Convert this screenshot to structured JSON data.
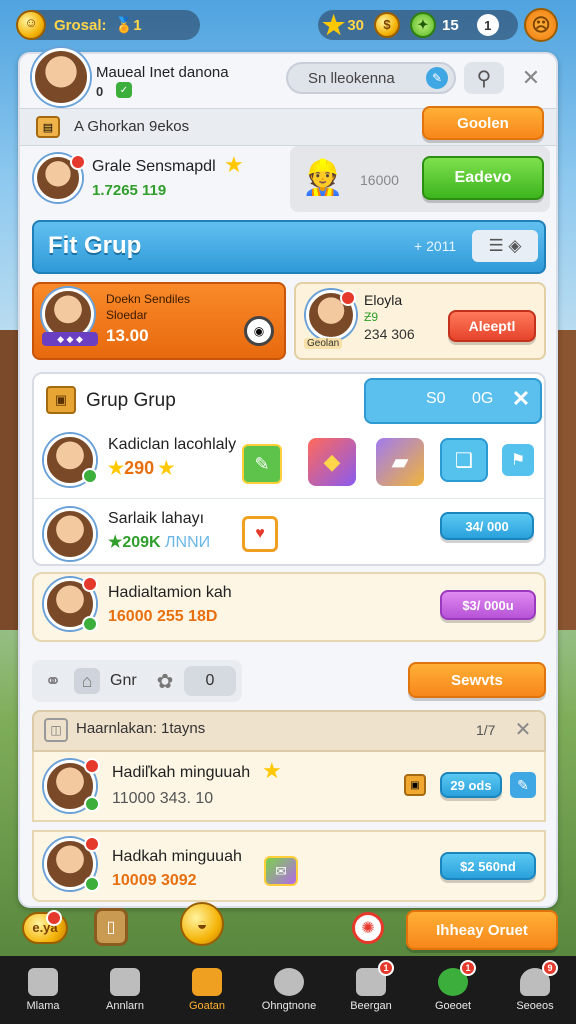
{
  "top": {
    "name": "Grosal:",
    "level": "🏅1",
    "stars": "30",
    "gems": "15",
    "notif": "1"
  },
  "profile": {
    "name": "Maueal Inet danona",
    "sub": "0",
    "search_placeholder": "Sn lleokenna",
    "section_label": "A Ghorkan 9ekos",
    "section_button": "Goolen"
  },
  "player": {
    "name": "Grale Sensmapdl",
    "score": "1.7265 119",
    "card_label": "16000",
    "card_sub": "",
    "button": "Eadevo"
  },
  "header": {
    "title": "Fit Grup",
    "count": "+ 2011"
  },
  "cards": {
    "left": {
      "line1": "Doekn Sendiles",
      "line2": "Sloedar",
      "value": "13.00"
    },
    "right": {
      "name": "Eloyla",
      "line2": "Ƶ9",
      "value": "234 306",
      "tag": "Geolan",
      "button": "Aleeptl"
    }
  },
  "group": {
    "title": "Grup Grup",
    "pill_a": "S0",
    "pill_b": "0G",
    "members": [
      {
        "name": "Kadiclan lacohlaly",
        "score": "290"
      },
      {
        "name": "Sarlaik lahayı",
        "score": "209K",
        "extra": "ЛNNИ",
        "price": "34/ 000"
      }
    ]
  },
  "gift": {
    "name": "Hadialtamion kah",
    "value": "16000 255 18D",
    "button": "$3/ 000u"
  },
  "toolbar": {
    "label": "Gnr",
    "num": "0",
    "button": "Sewvts"
  },
  "history": {
    "title": "Haarnlakan: 1tayns",
    "count": "1/7",
    "items": [
      {
        "name": "Hadiľkah minguuah",
        "value": "11000 343. 10",
        "price": "29 ods"
      },
      {
        "name": "Hadkah minguuah",
        "value": "10009 3092",
        "price": "$2 560nd"
      }
    ]
  },
  "bottom": {
    "coins": "e.ya",
    "button": "Ihheay Oruet"
  },
  "nav": [
    {
      "label": "Mlama",
      "active": false,
      "badge": ""
    },
    {
      "label": "Annlarn",
      "active": false,
      "badge": ""
    },
    {
      "label": "Goatan",
      "active": true,
      "badge": ""
    },
    {
      "label": "Ohngtnone",
      "active": false,
      "badge": ""
    },
    {
      "label": "Beergan",
      "active": false,
      "badge": "1"
    },
    {
      "label": "Goeoet",
      "active": false,
      "badge": "1"
    },
    {
      "label": "Seoeos",
      "active": false,
      "badge": "9"
    }
  ],
  "colors": {
    "accent": "#2aa1dc",
    "orange": "#f7871a",
    "green": "#3cb51e"
  }
}
